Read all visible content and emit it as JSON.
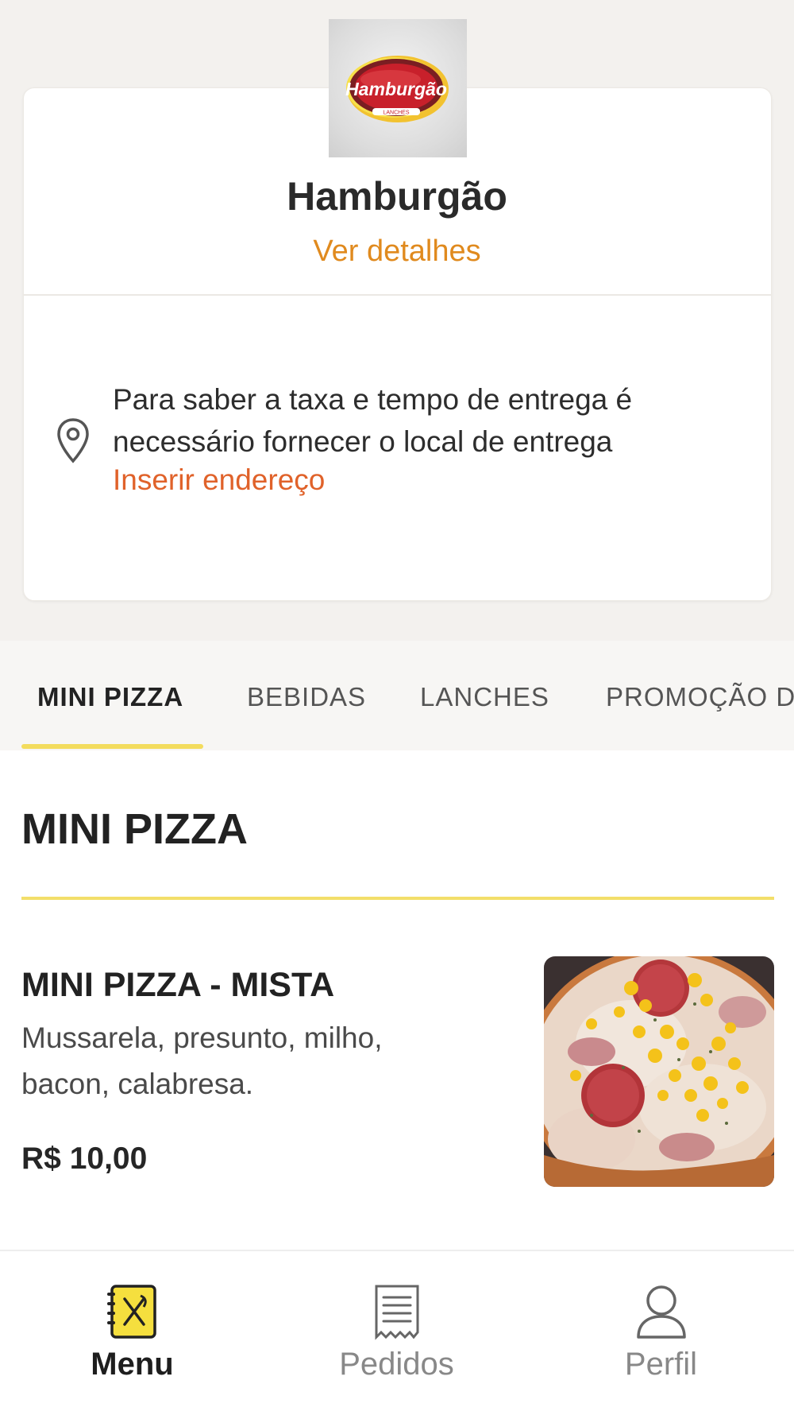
{
  "store": {
    "logo_text": "Hamburgão",
    "logo_subtext": "LANCHES",
    "name": "Hamburgão",
    "details_link": "Ver detalhes",
    "delivery_line1": "Para saber a taxa e tempo de entrega é",
    "delivery_line2": "necessário fornecer o local de entrega",
    "address_link": "Inserir endereço",
    "location_icon": "map-pin-icon"
  },
  "tabs": [
    {
      "label": "MINI PIZZA",
      "active": true
    },
    {
      "label": "BEBIDAS",
      "active": false
    },
    {
      "label": "LANCHES",
      "active": false
    },
    {
      "label": "PROMOÇÃO DO",
      "active": false
    }
  ],
  "section": {
    "title": "MINI PIZZA"
  },
  "products": [
    {
      "name": "MINI PIZZA - MISTA",
      "description_line1": "Mussarela, presunto, milho,",
      "description_line2": "bacon, calabresa.",
      "price": "R$ 10,00",
      "image": "pizza-photo"
    }
  ],
  "bottom_nav": [
    {
      "label": "Menu",
      "icon": "menu-book-icon",
      "active": true
    },
    {
      "label": "Pedidos",
      "icon": "receipt-icon",
      "active": false
    },
    {
      "label": "Perfil",
      "icon": "user-icon",
      "active": false
    }
  ],
  "colors": {
    "accent_yellow": "#f3dc5d",
    "link_orange": "#e08a1e",
    "address_orange": "#e0622a",
    "header_bg": "#f3f1ee"
  }
}
